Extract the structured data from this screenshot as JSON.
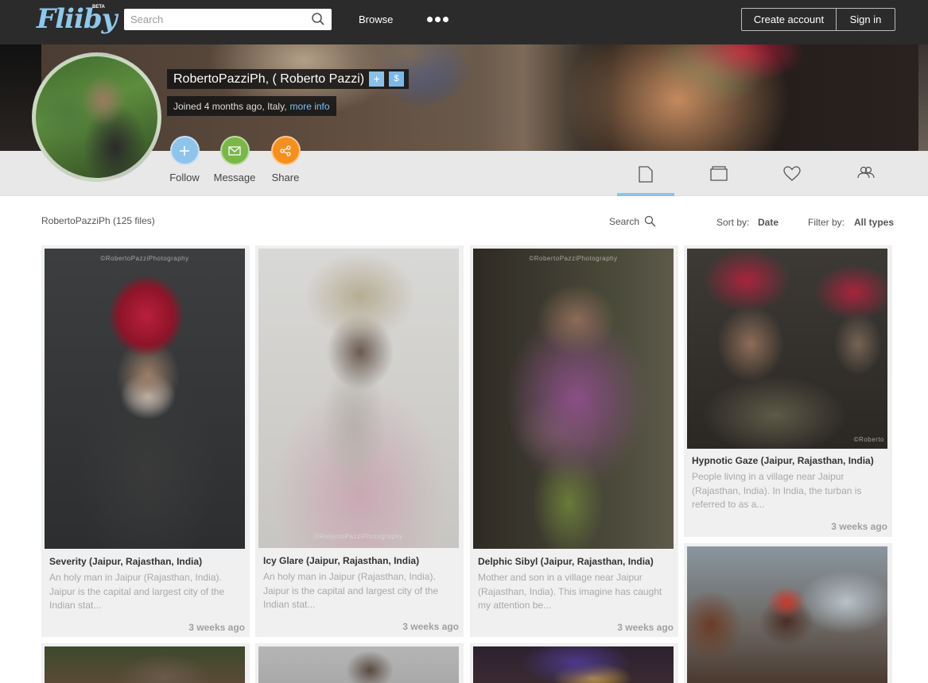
{
  "nav": {
    "logo_text": "Fliiby",
    "logo_badge": "BETA",
    "search_placeholder": "Search",
    "browse": "Browse",
    "create_account": "Create account",
    "sign_in": "Sign in",
    "icons": [
      "search-icon",
      "more-dots-icon"
    ]
  },
  "profile": {
    "name": "RobertoPazziPh, ( Roberto Pazzi)",
    "add_btn": "+",
    "money_btn": "$",
    "joined": "Joined 4 months ago, Italy,",
    "more_info": "more info",
    "actions": [
      {
        "label": "Follow",
        "icon": "plus-icon",
        "color": "#8ec3ea"
      },
      {
        "label": "Message",
        "icon": "envelope-icon",
        "color": "#7ab648"
      },
      {
        "label": "Share",
        "icon": "share-icon",
        "color": "#f5901e"
      }
    ],
    "tabs": [
      "files-icon",
      "folder-icon",
      "heart-icon",
      "people-icon"
    ],
    "active_tab": "files-icon"
  },
  "toolbar": {
    "files_count": "RobertoPazziPh (125 files)",
    "search": "Search",
    "sort_label": "Sort by:",
    "sort_value": "Date",
    "filter_label": "Filter by:",
    "filter_value": "All types"
  },
  "cards": [
    {
      "title": "Severity (Jaipur, Rajasthan, India)",
      "desc": "An holy man in Jaipur (Rajasthan, India). Jaipur is the capital and largest city of the Indian stat...",
      "date": "3 weeks ago",
      "watermark": "©RobertoPazziPhotography"
    },
    {
      "title": "Icy Glare (Jaipur, Rajasthan, India)",
      "desc": "An holy man in Jaipur (Rajasthan, India). Jaipur is the capital and largest city of the Indian stat...",
      "date": "3 weeks ago",
      "watermark": "©RobertoPazziPhotography"
    },
    {
      "title": "Delphic Sibyl (Jaipur, Rajasthan, India)",
      "desc": "Mother and son in a village near Jaipur (Rajasthan, India). This imagine has caught my attention be...",
      "date": "3 weeks ago",
      "watermark": "©RobertoPazziPhotography"
    },
    {
      "title": "Hypnotic Gaze (Jaipur, Rajasthan, India)",
      "desc": "People living in a village near Jaipur (Rajasthan, India). In India, the turban is referred to as a...",
      "date": "3 weeks ago",
      "watermark": "©Roberto"
    }
  ],
  "colors": {
    "navbar_bg": "#2b2b2b",
    "accent_blue": "#8ec3ea",
    "card_bg": "#f0f0f0"
  }
}
